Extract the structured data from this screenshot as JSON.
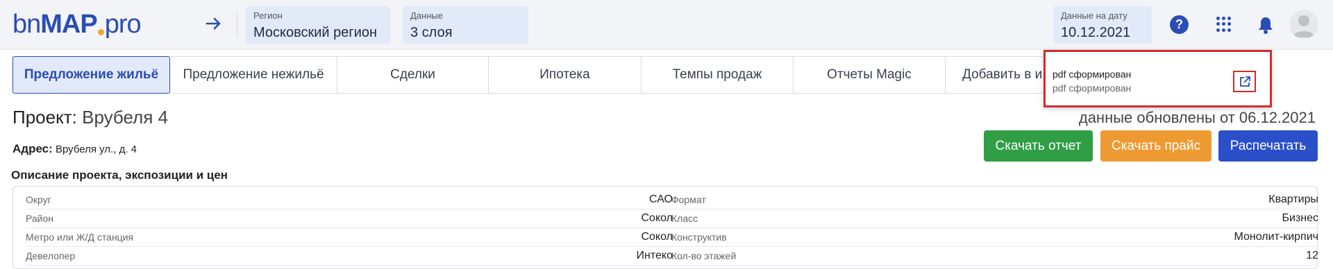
{
  "app": {
    "logo_text_a": "bn",
    "logo_text_b": "MAP",
    "logo_text_c": "pro"
  },
  "header": {
    "region_label": "Регион",
    "region_value": "Московский регион",
    "data_label": "Данные",
    "data_value": "3 слоя",
    "date_label": "Данные на дату",
    "date_value": "10.12.2021",
    "help_glyph": "?"
  },
  "tabs": [
    {
      "label": "Предложение жильё",
      "active": true
    },
    {
      "label": "Предложение нежильё",
      "active": false
    },
    {
      "label": "Сделки",
      "active": false
    },
    {
      "label": "Ипотека",
      "active": false
    },
    {
      "label": "Темпы продаж",
      "active": false
    },
    {
      "label": "Отчеты Magic",
      "active": false
    },
    {
      "label": "Добавить в и",
      "active": false
    }
  ],
  "project": {
    "label": "Проект:",
    "name": "Врубеля 4",
    "updated": "данные обновлены от 06.12.2021",
    "address_label": "Адрес:",
    "address_value": "Врубеля ул., д. 4"
  },
  "actions": {
    "download_report": "Скачать отчет",
    "download_price": "Скачать прайс",
    "print": "Распечатать"
  },
  "section": {
    "title": "Описание проекта, экспозиции и цен"
  },
  "info_left": [
    {
      "key": "Округ",
      "value": "САО"
    },
    {
      "key": "Район",
      "value": "Сокол"
    },
    {
      "key": "Метро или Ж/Д станция",
      "value": "Сокол"
    },
    {
      "key": "Девелопер",
      "value": "Интеко"
    }
  ],
  "info_right": [
    {
      "key": "Формат",
      "value": "Квартиры"
    },
    {
      "key": "Класс",
      "value": "Бизнес"
    },
    {
      "key": "Конструктив",
      "value": "Монолит-кирпич"
    },
    {
      "key": "Кол-во этажей",
      "value": "12"
    }
  ],
  "notification": {
    "title": "pdf сформирован",
    "subtitle": "pdf сформирован"
  },
  "colors": {
    "brand": "#2a4db5",
    "accent_pin": "#f0a53a",
    "green": "#2f9e44",
    "orange": "#ee9a33",
    "blue": "#2a4fc9",
    "highlight": "#d42a2a"
  },
  "icons": [
    "arrow-right-icon",
    "help-icon",
    "apps-grid-icon",
    "bell-icon",
    "user-avatar-icon",
    "open-external-icon"
  ]
}
